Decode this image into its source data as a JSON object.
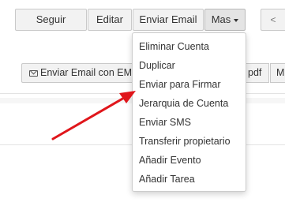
{
  "toolbar": {
    "seguir_label": "Seguir",
    "editar_label": "Editar",
    "enviar_email_label": "Enviar Email",
    "mas_label": "Mas",
    "prev_glyph": "<"
  },
  "secondary_toolbar": {
    "email_template_label": "Enviar Email con EMA",
    "pdf_label": "pdf",
    "m_label": "M"
  },
  "dropdown": {
    "items": [
      {
        "label": "Eliminar Cuenta"
      },
      {
        "label": "Duplicar"
      },
      {
        "label": "Enviar para Firmar"
      },
      {
        "label": "Jerarquia de Cuenta"
      },
      {
        "label": "Enviar SMS"
      },
      {
        "label": "Transferir propietario"
      },
      {
        "label": "Añadir Evento"
      },
      {
        "label": "Añadir Tarea"
      }
    ]
  },
  "icons": {
    "email_template": "envelope-icon",
    "mas_caret": "caret-down-icon",
    "prev": "chevron-left-icon"
  },
  "colors": {
    "annotation_arrow": "#e0161b",
    "button_bg": "#f2f2f2",
    "button_border": "#c9c9c9",
    "active_button_bg": "#e4e4e4"
  }
}
